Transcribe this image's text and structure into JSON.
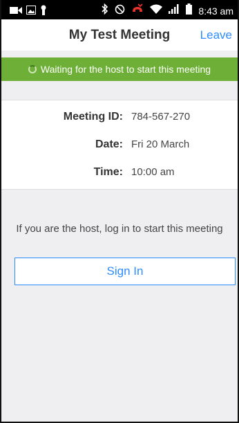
{
  "status_bar": {
    "time": "8:43 am",
    "icons": [
      "video-icon",
      "image-icon",
      "keyhole-icon",
      "bluetooth-icon",
      "do-not-disturb-icon",
      "missed-call-icon",
      "wifi-icon",
      "signal-icon",
      "battery-icon"
    ]
  },
  "header": {
    "title": "My Test Meeting",
    "leave_label": "Leave"
  },
  "banner": {
    "text": "Waiting for the host to start this meeting",
    "color": "#6eb037"
  },
  "meeting": {
    "id_label": "Meeting ID:",
    "id_value": "784-567-270",
    "date_label": "Date:",
    "date_value": "Fri 20 March",
    "time_label": "Time:",
    "time_value": "10:00 am"
  },
  "host_message": "If you are the host, log in to start this meeting",
  "signin_label": "Sign In",
  "accent_color": "#2d8cff"
}
